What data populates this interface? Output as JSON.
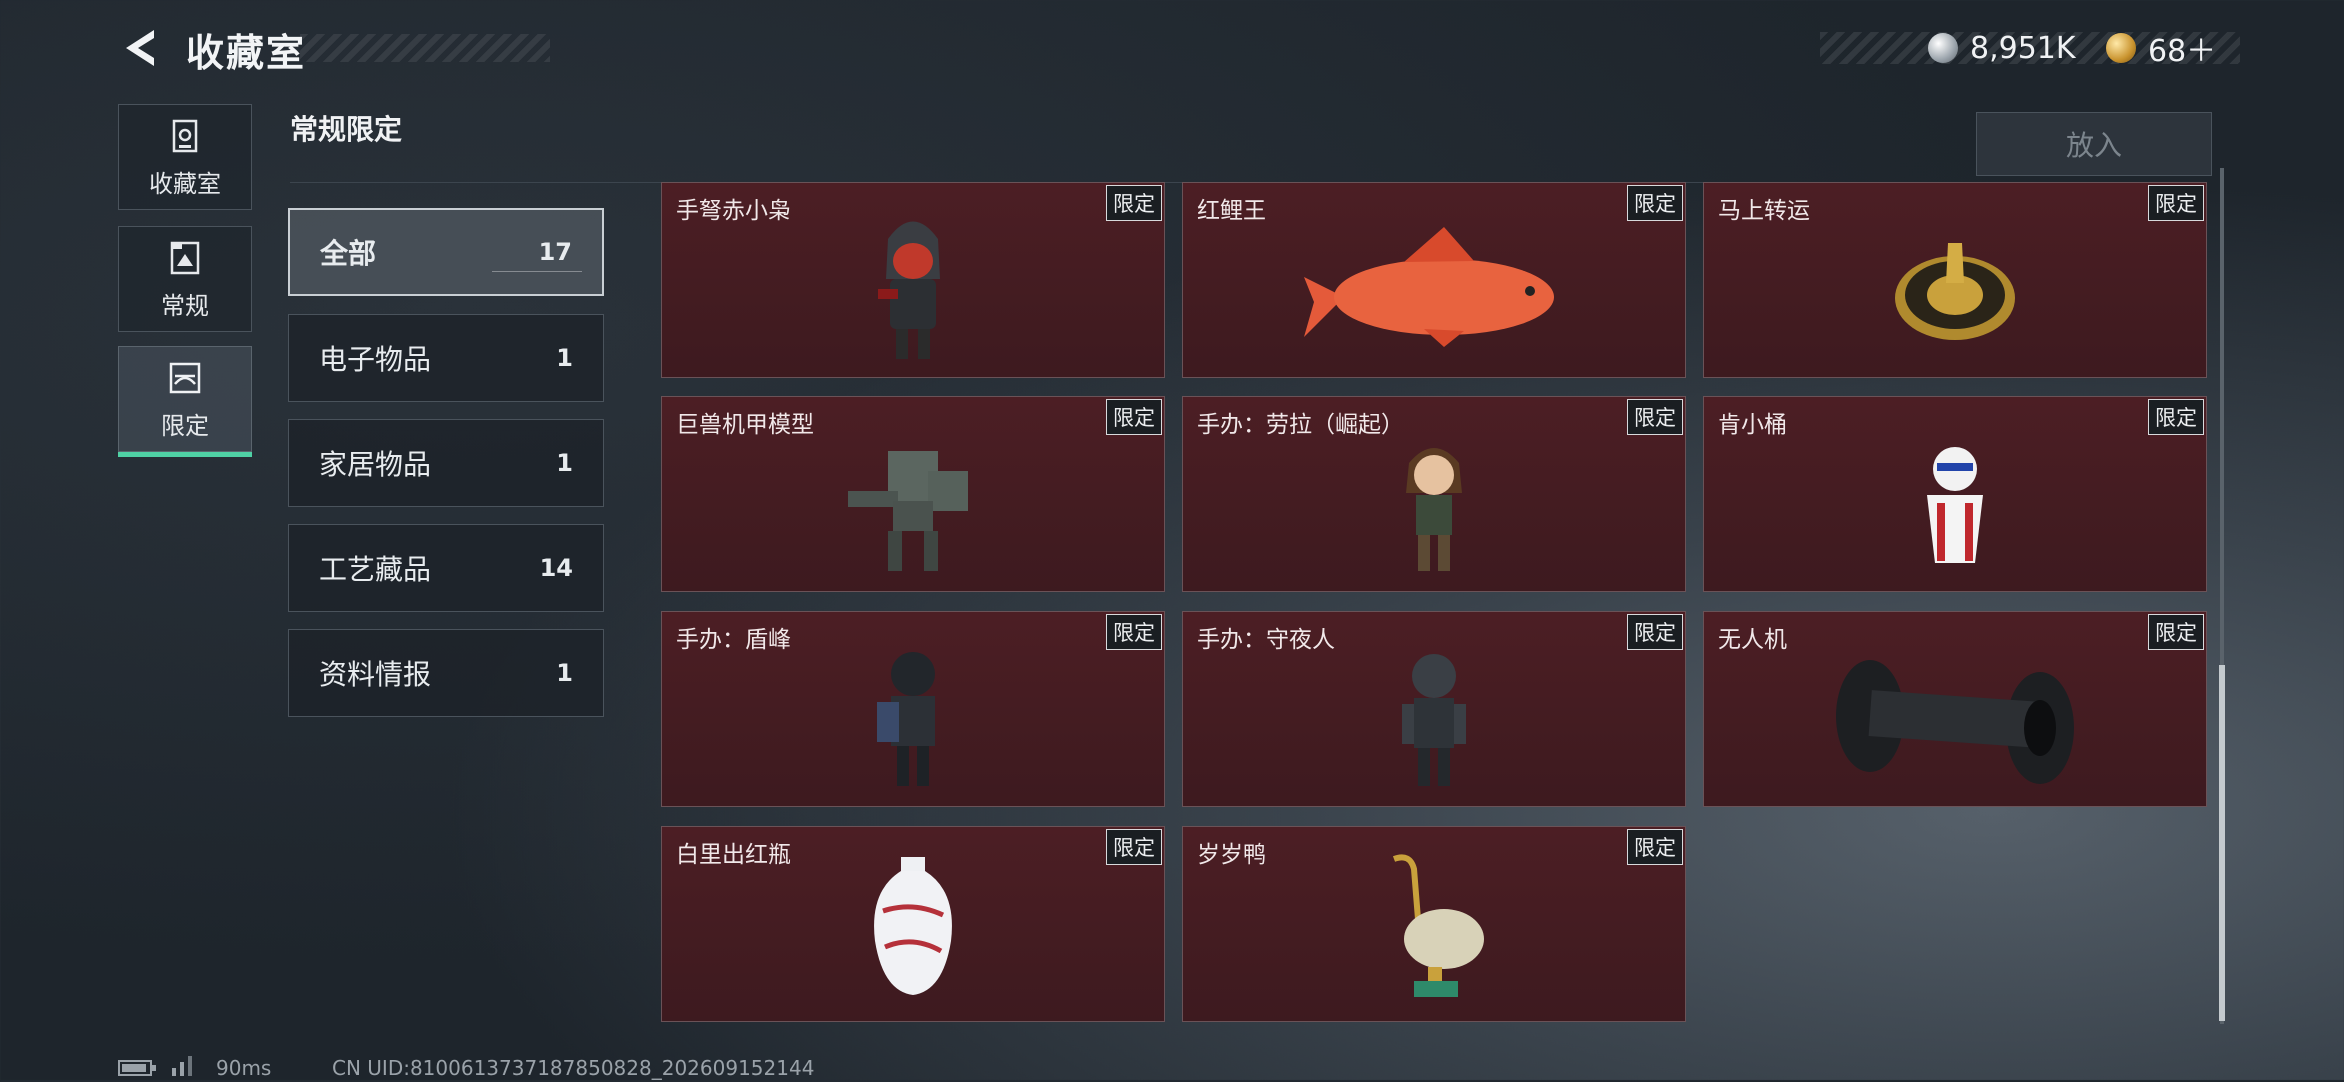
{
  "header": {
    "title": "收藏室",
    "currency_silver": "8,951K",
    "currency_gold": "68＋"
  },
  "nav": [
    {
      "label": "收藏室",
      "icon": "vault-icon"
    },
    {
      "label": "常规",
      "icon": "regular-icon"
    },
    {
      "label": "限定",
      "icon": "limited-icon"
    }
  ],
  "section_title": "常规限定",
  "put_button": "放入",
  "categories": [
    {
      "label": "全部",
      "count": "17"
    },
    {
      "label": "电子物品",
      "count": "1"
    },
    {
      "label": "家居物品",
      "count": "1"
    },
    {
      "label": "工艺藏品",
      "count": "14"
    },
    {
      "label": "资料情报",
      "count": "1"
    }
  ],
  "tag_label": "限定",
  "items": [
    {
      "name": "手弩赤小枭",
      "icon": "hooded-figure-icon"
    },
    {
      "name": "红鲤王",
      "icon": "red-carp-icon"
    },
    {
      "name": "马上转运",
      "icon": "golden-horse-disc-icon"
    },
    {
      "name": "巨兽机甲模型",
      "icon": "mech-model-icon"
    },
    {
      "name": "手办：劳拉（崛起）",
      "icon": "lara-figure-icon"
    },
    {
      "name": "肯小桶",
      "icon": "colonel-bucket-icon"
    },
    {
      "name": "手办：盾峰",
      "icon": "shield-soldier-figure-icon"
    },
    {
      "name": "手办：守夜人",
      "icon": "night-watcher-figure-icon"
    },
    {
      "name": "无人机",
      "icon": "drone-roller-icon"
    },
    {
      "name": "白里出红瓶",
      "icon": "porcelain-vase-icon"
    },
    {
      "name": "岁岁鸭",
      "icon": "cloisonne-duck-icon"
    }
  ],
  "status": {
    "ping": "90ms",
    "uid": "CN UID:8100613737187850828_202609152144"
  },
  "colors": {
    "accent": "#4fd1a5",
    "card_bg": "#4c1e24"
  }
}
